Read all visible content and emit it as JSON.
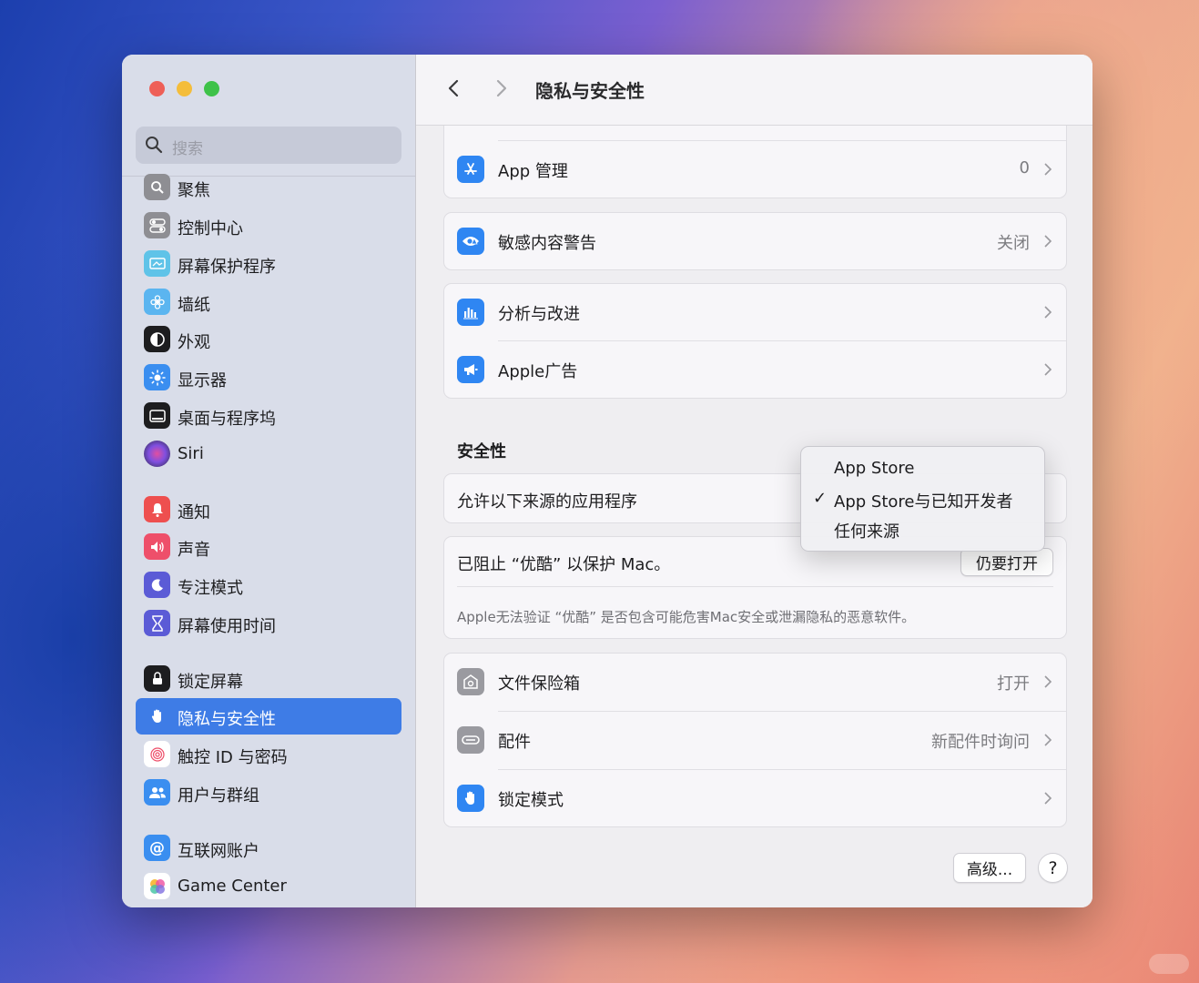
{
  "window": {
    "title": "隐私与安全性"
  },
  "search": {
    "placeholder": "搜索"
  },
  "sidebar": {
    "items": [
      {
        "label": "聚焦"
      },
      {
        "label": "控制中心"
      },
      {
        "label": "屏幕保护程序"
      },
      {
        "label": "墙纸"
      },
      {
        "label": "外观"
      },
      {
        "label": "显示器"
      },
      {
        "label": "桌面与程序坞"
      },
      {
        "label": "Siri"
      },
      {
        "label": "通知"
      },
      {
        "label": "声音"
      },
      {
        "label": "专注模式"
      },
      {
        "label": "屏幕使用时间"
      },
      {
        "label": "锁定屏幕"
      },
      {
        "label": "隐私与安全性"
      },
      {
        "label": "触控 ID 与密码"
      },
      {
        "label": "用户与群组"
      },
      {
        "label": "互联网账户"
      },
      {
        "label": "Game Center"
      }
    ]
  },
  "main": {
    "app_management": {
      "label": "App 管理",
      "value": "0"
    },
    "sensitive": {
      "label": "敏感内容警告",
      "value": "关闭"
    },
    "analytics": {
      "label": "分析与改进"
    },
    "apple_ads": {
      "label": "Apple广告"
    },
    "security_title": "安全性",
    "allow_apps": {
      "label": "允许以下来源的应用程序"
    },
    "blocked": {
      "label": "已阻止 “优酷” 以保护 Mac。",
      "button": "仍要打开",
      "note": "Apple无法验证 “优酷” 是否包含可能危害Mac安全或泄漏隐私的恶意软件。"
    },
    "filevault": {
      "label": "文件保险箱",
      "value": "打开"
    },
    "accessories": {
      "label": "配件",
      "value": "新配件时询问"
    },
    "lockdown": {
      "label": "锁定模式"
    },
    "advanced_button": "高级...",
    "help_button": "?"
  },
  "dropdown": {
    "options": [
      "App Store",
      "App Store与已知开发者",
      "任何来源"
    ],
    "checkmark": "✓"
  },
  "colors": {
    "accent": "#3e7ce6",
    "close": "#ee5f57",
    "minimize": "#f4bd3b",
    "zoom": "#3ec249"
  }
}
